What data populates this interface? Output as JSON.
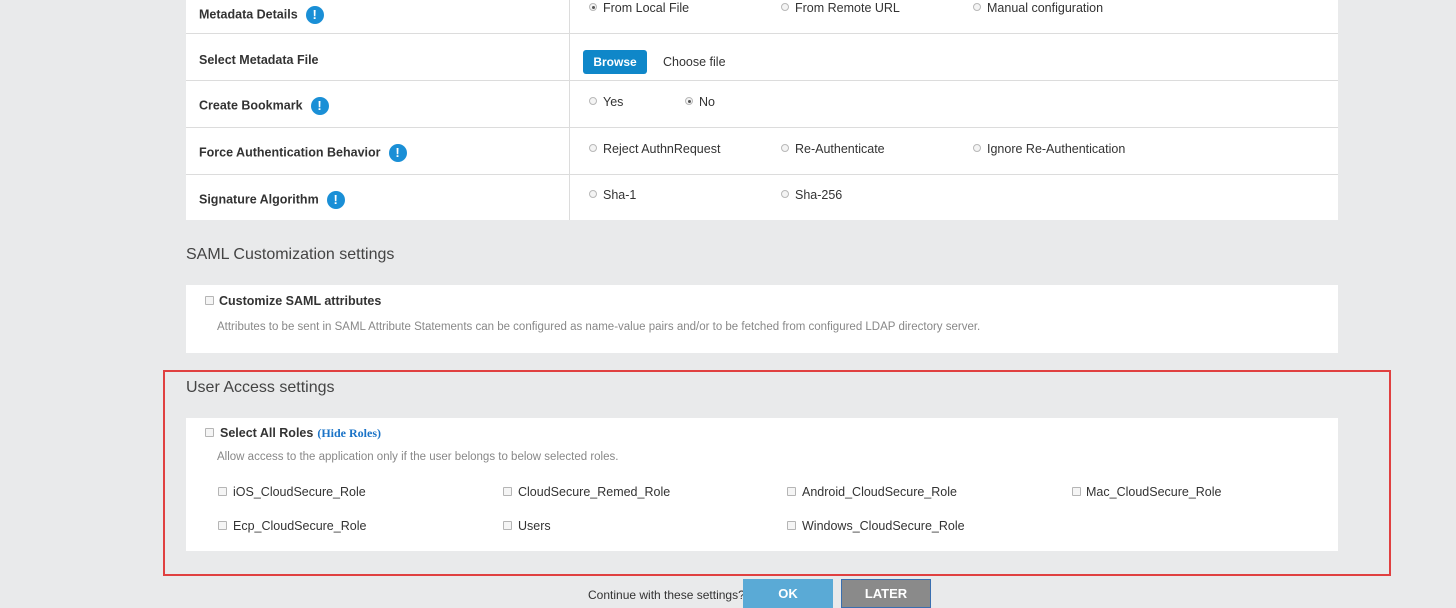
{
  "config": {
    "metadata_details": {
      "label": "Metadata Details",
      "options": [
        "From Local File",
        "From Remote URL",
        "Manual configuration"
      ],
      "selected": "From Local File"
    },
    "select_metadata_file": {
      "label": "Select Metadata File",
      "browse_label": "Browse",
      "file_text": "Choose file"
    },
    "create_bookmark": {
      "label": "Create Bookmark",
      "options": [
        "Yes",
        "No"
      ],
      "selected": "No"
    },
    "force_auth": {
      "label": "Force Authentication Behavior",
      "options": [
        "Reject AuthnRequest",
        "Re-Authenticate",
        "Ignore Re-Authentication"
      ]
    },
    "signature_algorithm": {
      "label": "Signature Algorithm",
      "options": [
        "Sha-1",
        "Sha-256"
      ]
    },
    "info_glyph": "!"
  },
  "saml_customization": {
    "title": "SAML Customization settings",
    "checkbox_label": "Customize SAML attributes",
    "description": "Attributes to be sent in SAML Attribute Statements can be configured as name-value pairs and/or to be fetched from configured LDAP directory server."
  },
  "user_access": {
    "title": "User Access settings",
    "select_all_label": "Select All Roles",
    "hide_roles_link": "(Hide Roles)",
    "description": "Allow access to the application only if the user belongs to below selected roles.",
    "roles": [
      "iOS_CloudSecure_Role",
      "CloudSecure_Remed_Role",
      "Android_CloudSecure_Role",
      "Mac_CloudSecure_Role",
      "Ecp_CloudSecure_Role",
      "Users",
      "Windows_CloudSecure_Role"
    ]
  },
  "footer": {
    "prompt": "Continue with these settings?",
    "ok_label": "OK",
    "later_label": "LATER"
  },
  "colors": {
    "accent": "#0f87c9",
    "highlight_border": "#e04040",
    "background": "#e9eaeb"
  }
}
